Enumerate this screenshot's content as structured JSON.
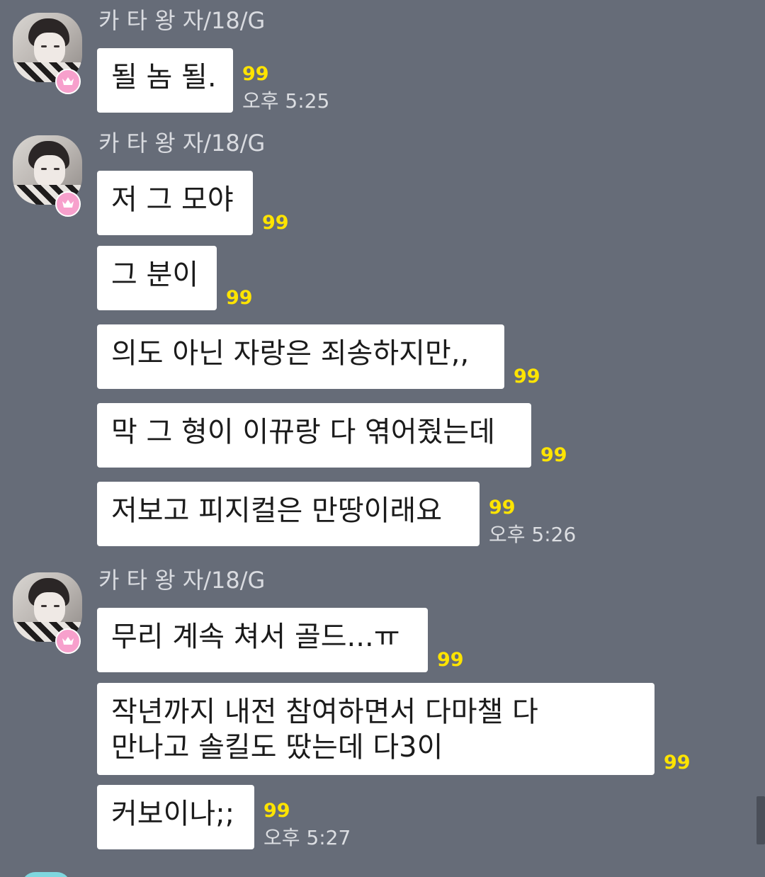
{
  "sender_name": "카 타 왕 자/18/G",
  "groups": [
    {
      "messages": [
        {
          "text": "될 놈 될.",
          "unread": "99",
          "time": "오후 5:25"
        }
      ]
    },
    {
      "messages": [
        {
          "text": "저 그 모야",
          "unread": "99"
        },
        {
          "text": "그 분이",
          "unread": "99"
        },
        {
          "text": "의도 아닌 자랑은 죄송하지만,,",
          "unread": "99"
        },
        {
          "text": "막 그 형이 이뀨랑 다 엮어줬는데",
          "unread": "99"
        },
        {
          "text": "저보고 피지컬은 만땅이래요",
          "unread": "99",
          "time": "오후 5:26"
        }
      ]
    },
    {
      "messages": [
        {
          "text": "무리 계속 쳐서 골드...ㅠ",
          "unread": "99"
        },
        {
          "text_lines": [
            "작년까지 내전 참여하면서 다마챌 다",
            "만나고 솔킬도 땄는데 다3이"
          ],
          "unread": "99"
        },
        {
          "text": "커보이나;;",
          "unread": "99",
          "time": "오후 5:27"
        }
      ]
    }
  ],
  "icons": {
    "avatar_badge": "crown-icon",
    "badge_color": "#f7a0cc",
    "unread_color": "#ffe400",
    "background_color": "#666c78"
  }
}
